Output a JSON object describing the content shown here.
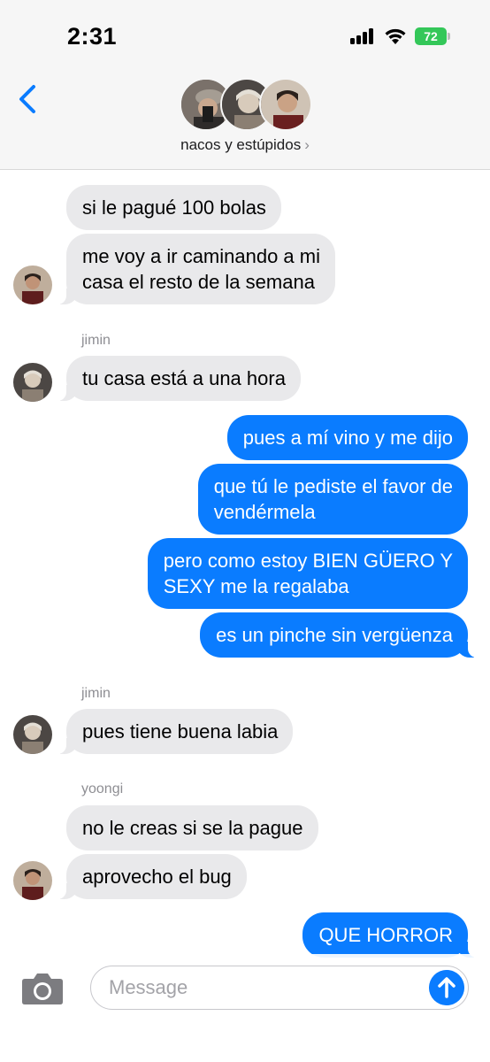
{
  "status_bar": {
    "time": "2:31",
    "battery": "72"
  },
  "header": {
    "group_name": "nacos y estúpidos",
    "chevron": "›",
    "back_icon": "chevron-left-icon"
  },
  "messages": [
    {
      "text": "si le pagué 100 bolas",
      "sender": "",
      "direction": "incoming"
    },
    {
      "text_lines": [
        "me voy a ir caminando a mi",
        "casa el resto de la semana"
      ],
      "sender": "",
      "direction": "incoming"
    },
    {
      "text": "tu casa está a una hora",
      "sender": "jimin",
      "direction": "incoming"
    },
    {
      "text": "pues a mí vino y me dijo",
      "direction": "outgoing"
    },
    {
      "text_lines": [
        "que tú le pediste el favor de",
        "vendérmela"
      ],
      "direction": "outgoing"
    },
    {
      "text_lines": [
        "pero como estoy BIEN GÜERO Y",
        "SEXY me la regalaba"
      ],
      "direction": "outgoing"
    },
    {
      "text": "es un pinche sin vergüenza",
      "direction": "outgoing"
    },
    {
      "text": "pues tiene buena labia",
      "sender": "jimin",
      "direction": "incoming"
    },
    {
      "text": "no le creas si se la pague",
      "sender": "yoongi",
      "direction": "incoming"
    },
    {
      "text": "aprovecho el bug",
      "sender": "",
      "direction": "incoming"
    },
    {
      "text": "QUE HORROR",
      "direction": "outgoing"
    }
  ],
  "input": {
    "placeholder": "Message",
    "camera_icon": "camera-icon",
    "send_icon": "arrow-up-icon"
  },
  "colors": {
    "outgoing_bubble": "#0a7cff",
    "incoming_bubble": "#e9e9eb",
    "battery": "#34c759",
    "accent": "#0a7cff"
  }
}
